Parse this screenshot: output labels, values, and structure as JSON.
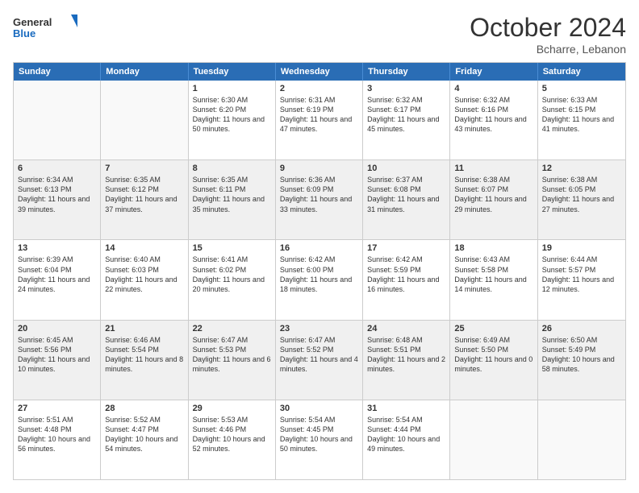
{
  "logo": {
    "line1": "General",
    "line2": "Blue"
  },
  "title": "October 2024",
  "location": "Bcharre, Lebanon",
  "days_of_week": [
    "Sunday",
    "Monday",
    "Tuesday",
    "Wednesday",
    "Thursday",
    "Friday",
    "Saturday"
  ],
  "weeks": [
    [
      {
        "day": "",
        "info": ""
      },
      {
        "day": "",
        "info": ""
      },
      {
        "day": "1",
        "info": "Sunrise: 6:30 AM\nSunset: 6:20 PM\nDaylight: 11 hours and 50 minutes."
      },
      {
        "day": "2",
        "info": "Sunrise: 6:31 AM\nSunset: 6:19 PM\nDaylight: 11 hours and 47 minutes."
      },
      {
        "day": "3",
        "info": "Sunrise: 6:32 AM\nSunset: 6:17 PM\nDaylight: 11 hours and 45 minutes."
      },
      {
        "day": "4",
        "info": "Sunrise: 6:32 AM\nSunset: 6:16 PM\nDaylight: 11 hours and 43 minutes."
      },
      {
        "day": "5",
        "info": "Sunrise: 6:33 AM\nSunset: 6:15 PM\nDaylight: 11 hours and 41 minutes."
      }
    ],
    [
      {
        "day": "6",
        "info": "Sunrise: 6:34 AM\nSunset: 6:13 PM\nDaylight: 11 hours and 39 minutes."
      },
      {
        "day": "7",
        "info": "Sunrise: 6:35 AM\nSunset: 6:12 PM\nDaylight: 11 hours and 37 minutes."
      },
      {
        "day": "8",
        "info": "Sunrise: 6:35 AM\nSunset: 6:11 PM\nDaylight: 11 hours and 35 minutes."
      },
      {
        "day": "9",
        "info": "Sunrise: 6:36 AM\nSunset: 6:09 PM\nDaylight: 11 hours and 33 minutes."
      },
      {
        "day": "10",
        "info": "Sunrise: 6:37 AM\nSunset: 6:08 PM\nDaylight: 11 hours and 31 minutes."
      },
      {
        "day": "11",
        "info": "Sunrise: 6:38 AM\nSunset: 6:07 PM\nDaylight: 11 hours and 29 minutes."
      },
      {
        "day": "12",
        "info": "Sunrise: 6:38 AM\nSunset: 6:05 PM\nDaylight: 11 hours and 27 minutes."
      }
    ],
    [
      {
        "day": "13",
        "info": "Sunrise: 6:39 AM\nSunset: 6:04 PM\nDaylight: 11 hours and 24 minutes."
      },
      {
        "day": "14",
        "info": "Sunrise: 6:40 AM\nSunset: 6:03 PM\nDaylight: 11 hours and 22 minutes."
      },
      {
        "day": "15",
        "info": "Sunrise: 6:41 AM\nSunset: 6:02 PM\nDaylight: 11 hours and 20 minutes."
      },
      {
        "day": "16",
        "info": "Sunrise: 6:42 AM\nSunset: 6:00 PM\nDaylight: 11 hours and 18 minutes."
      },
      {
        "day": "17",
        "info": "Sunrise: 6:42 AM\nSunset: 5:59 PM\nDaylight: 11 hours and 16 minutes."
      },
      {
        "day": "18",
        "info": "Sunrise: 6:43 AM\nSunset: 5:58 PM\nDaylight: 11 hours and 14 minutes."
      },
      {
        "day": "19",
        "info": "Sunrise: 6:44 AM\nSunset: 5:57 PM\nDaylight: 11 hours and 12 minutes."
      }
    ],
    [
      {
        "day": "20",
        "info": "Sunrise: 6:45 AM\nSunset: 5:56 PM\nDaylight: 11 hours and 10 minutes."
      },
      {
        "day": "21",
        "info": "Sunrise: 6:46 AM\nSunset: 5:54 PM\nDaylight: 11 hours and 8 minutes."
      },
      {
        "day": "22",
        "info": "Sunrise: 6:47 AM\nSunset: 5:53 PM\nDaylight: 11 hours and 6 minutes."
      },
      {
        "day": "23",
        "info": "Sunrise: 6:47 AM\nSunset: 5:52 PM\nDaylight: 11 hours and 4 minutes."
      },
      {
        "day": "24",
        "info": "Sunrise: 6:48 AM\nSunset: 5:51 PM\nDaylight: 11 hours and 2 minutes."
      },
      {
        "day": "25",
        "info": "Sunrise: 6:49 AM\nSunset: 5:50 PM\nDaylight: 11 hours and 0 minutes."
      },
      {
        "day": "26",
        "info": "Sunrise: 6:50 AM\nSunset: 5:49 PM\nDaylight: 10 hours and 58 minutes."
      }
    ],
    [
      {
        "day": "27",
        "info": "Sunrise: 5:51 AM\nSunset: 4:48 PM\nDaylight: 10 hours and 56 minutes."
      },
      {
        "day": "28",
        "info": "Sunrise: 5:52 AM\nSunset: 4:47 PM\nDaylight: 10 hours and 54 minutes."
      },
      {
        "day": "29",
        "info": "Sunrise: 5:53 AM\nSunset: 4:46 PM\nDaylight: 10 hours and 52 minutes."
      },
      {
        "day": "30",
        "info": "Sunrise: 5:54 AM\nSunset: 4:45 PM\nDaylight: 10 hours and 50 minutes."
      },
      {
        "day": "31",
        "info": "Sunrise: 5:54 AM\nSunset: 4:44 PM\nDaylight: 10 hours and 49 minutes."
      },
      {
        "day": "",
        "info": ""
      },
      {
        "day": "",
        "info": ""
      }
    ]
  ]
}
